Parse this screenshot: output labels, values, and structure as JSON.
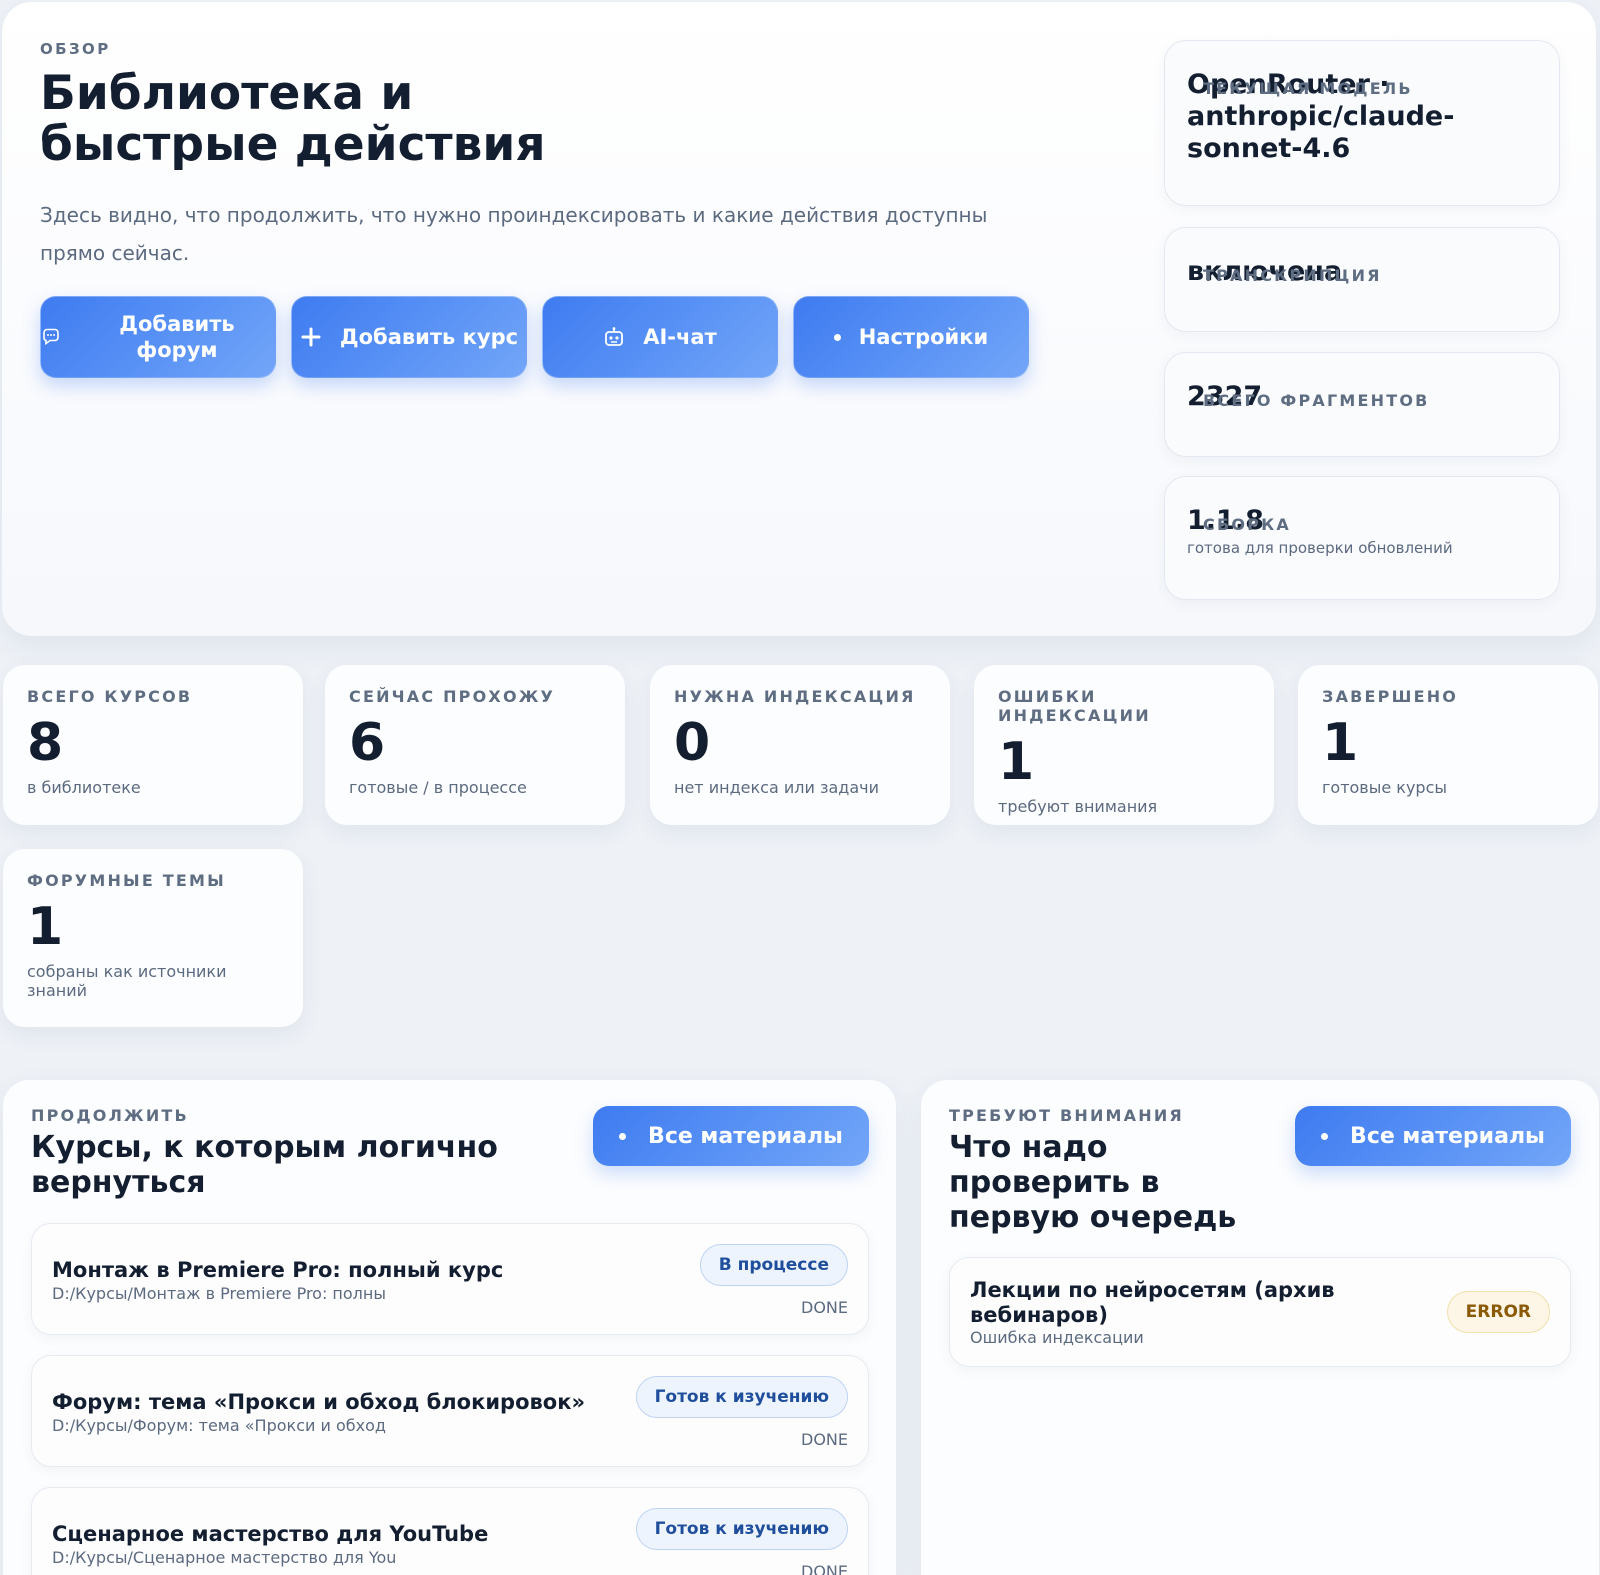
{
  "overview": {
    "eyebrow": "ОБЗОР",
    "title": "Библиотека и быстрые действия",
    "description": "Здесь видно, что продолжить, что нужно проиндексировать и какие действия доступны прямо сейчас.",
    "actions": [
      {
        "label": "Добавить форум",
        "icon": "chat-bubble-icon"
      },
      {
        "label": "Добавить курс",
        "icon": "plus-icon"
      },
      {
        "label": "AI-чат",
        "icon": "robot-icon"
      },
      {
        "label": "Настройки",
        "icon": "dot-icon"
      }
    ]
  },
  "info_cards": {
    "model": {
      "label": "ТЕКУЩАЯ МОДЕЛЬ",
      "value": "OpenRouter · anthropic/claude-sonnet-4.6"
    },
    "transcription": {
      "label": "ТРАНСКРИПЦИЯ",
      "value": "включена"
    },
    "fragments": {
      "label": "ВСЕГО ФРАГМЕНТОВ",
      "value": "2327"
    },
    "build": {
      "label": "СБОРКА",
      "value": "1.1.8",
      "note": "готова для проверки обновлений"
    }
  },
  "stats": [
    {
      "label": "ВСЕГО КУРСОВ",
      "value": "8",
      "sub": "в библиотеке"
    },
    {
      "label": "СЕЙЧАС ПРОХОЖУ",
      "value": "6",
      "sub": "готовые / в процессе"
    },
    {
      "label": "НУЖНА ИНДЕКСАЦИЯ",
      "value": "0",
      "sub": "нет индекса или задачи"
    },
    {
      "label": "ОШИБКИ ИНДЕКСАЦИИ",
      "value": "1",
      "sub": "требуют внимания"
    },
    {
      "label": "ЗАВЕРШЕНО",
      "value": "1",
      "sub": "готовые курсы"
    },
    {
      "label": "ФОРУМНЫЕ ТЕМЫ",
      "value": "1",
      "sub": "собраны как источники знаний"
    }
  ],
  "continue_panel": {
    "eyebrow": "ПРОДОЛЖИТЬ",
    "title": "Курсы, к которым логично вернуться",
    "button": "Все материалы",
    "items": [
      {
        "title": "Монтаж в Premiere Pro: полный курс",
        "path": "D:/Курсы/Монтаж в Premiere Pro: полны",
        "status": "В процессе",
        "state": "DONE"
      },
      {
        "title": "Форум: тема «Прокси и обход блокировок»",
        "path": "D:/Курсы/Форум: тема «Прокси и обход",
        "status": "Готов к изучению",
        "state": "DONE"
      },
      {
        "title": "Сценарное мастерство для YouTube",
        "path": "D:/Курсы/Сценарное мастерство для You",
        "status": "Готов к изучению",
        "state": "DONE"
      }
    ]
  },
  "attention_panel": {
    "eyebrow": "ТРЕБУЮТ ВНИМАНИЯ",
    "title": "Что надо проверить в первую очередь",
    "button": "Все материалы",
    "items": [
      {
        "title": "Лекции по нейросетям (архив вебинаров)",
        "path": "Ошибка индексации",
        "status": "ERROR"
      }
    ]
  },
  "colors": {
    "accent": "#3e7bf0",
    "background": "#eef2f7",
    "text": "#131e30",
    "muted": "#5c6a80",
    "error_pill_bg": "#fdf6e6",
    "error_pill_text": "#8a5a06"
  }
}
